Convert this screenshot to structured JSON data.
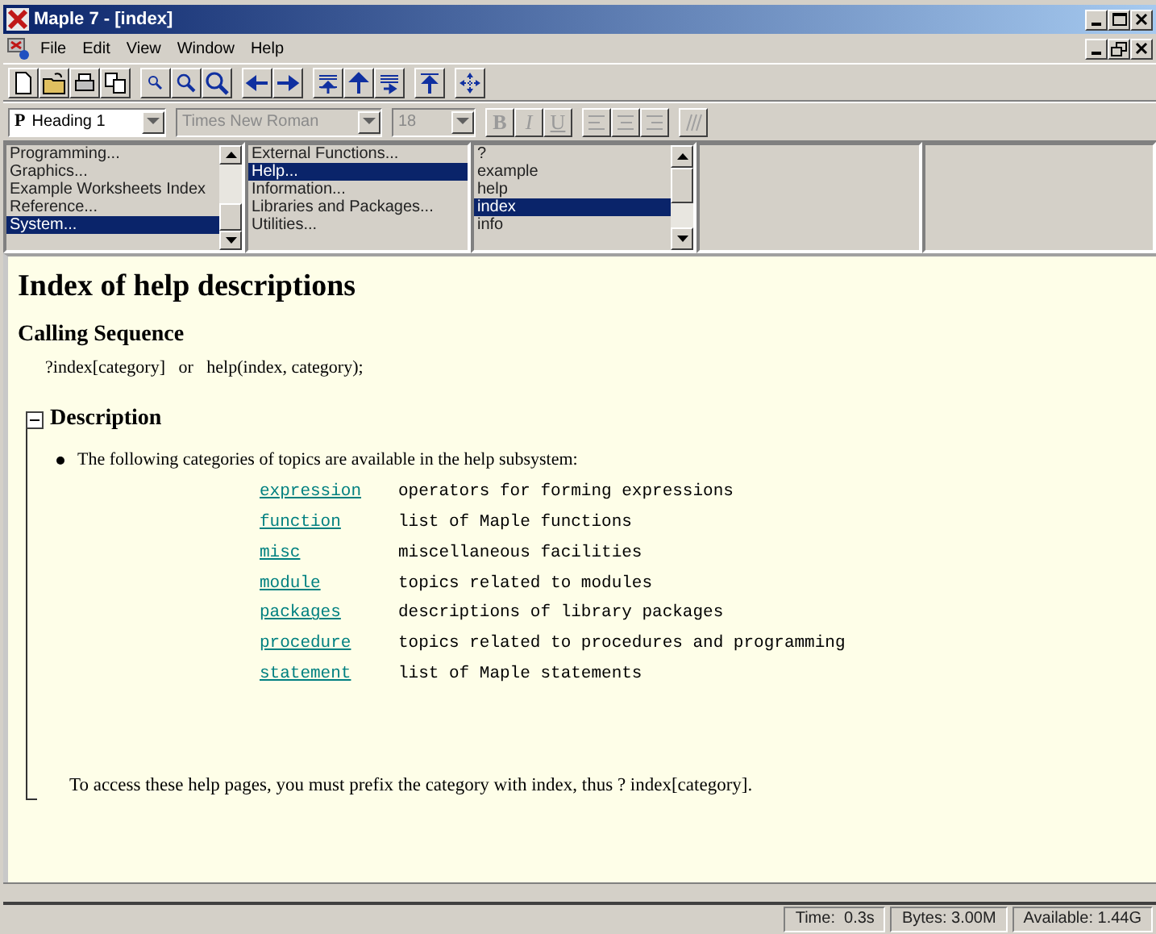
{
  "window": {
    "title": "Maple 7 - [index]"
  },
  "menu": [
    "File",
    "Edit",
    "View",
    "Window",
    "Help"
  ],
  "format_bar": {
    "style": {
      "mark": "P",
      "value": "Heading 1"
    },
    "font": {
      "value": "Times New Roman",
      "disabled": true
    },
    "size": {
      "value": "18",
      "disabled": true
    },
    "text_buttons": [
      {
        "label": "B",
        "disabled": true
      },
      {
        "label": "I",
        "disabled": true
      },
      {
        "label": "U",
        "disabled": true
      }
    ],
    "align_buttons": [
      {
        "disabled": true
      },
      {
        "disabled": true
      },
      {
        "disabled": true
      }
    ],
    "execution_group": {
      "disabled": true
    }
  },
  "browser": {
    "panes": [
      {
        "items": [
          {
            "label": "Programming...",
            "selected": false
          },
          {
            "label": "Graphics...",
            "selected": false
          },
          {
            "label": "Example Worksheets Index",
            "selected": false
          },
          {
            "label": "Reference...",
            "selected": false
          },
          {
            "label": "System...",
            "selected": true
          }
        ]
      },
      {
        "items": [
          {
            "label": "External Functions...",
            "selected": false
          },
          {
            "label": "Help...",
            "selected": true
          },
          {
            "label": "Information...",
            "selected": false
          },
          {
            "label": "Libraries and Packages...",
            "selected": false
          },
          {
            "label": "Utilities...",
            "selected": false
          }
        ]
      },
      {
        "items": [
          {
            "label": "?",
            "selected": false
          },
          {
            "label": "example",
            "selected": false
          },
          {
            "label": "help",
            "selected": false
          },
          {
            "label": "index",
            "selected": true
          },
          {
            "label": "info",
            "selected": false
          }
        ]
      }
    ]
  },
  "document": {
    "title": "Index of help descriptions",
    "calling_sequence": {
      "heading": "Calling Sequence",
      "text": "?index[category]   or   help(index, category);"
    },
    "description": {
      "heading": "Description",
      "expanded": true,
      "intro": "The following categories of topics are available in the help subsystem:",
      "topics": [
        {
          "name": "expression",
          "description": "operators for forming expressions"
        },
        {
          "name": "function",
          "description": "list of Maple functions"
        },
        {
          "name": "misc",
          "description": "miscellaneous facilities"
        },
        {
          "name": "module",
          "description": "topics related to modules"
        },
        {
          "name": "packages",
          "description": "descriptions of library packages"
        },
        {
          "name": "procedure",
          "description": "topics related to procedures and programming"
        },
        {
          "name": "statement",
          "description": "list of Maple statements"
        }
      ],
      "note": "To access these help pages, you must prefix the category with index, thus ? index[category]."
    }
  },
  "status_bar": [
    "Time:  0.3s",
    "Bytes: 3.00M",
    "Available: 1.44G"
  ]
}
